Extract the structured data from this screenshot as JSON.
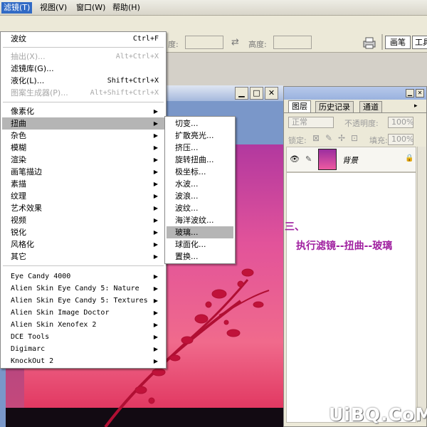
{
  "menubar": {
    "items": [
      "滤镜(T)",
      "视图(V)",
      "窗口(W)",
      "帮助(H)"
    ]
  },
  "optionsbar": {
    "partial_label": "度:",
    "swap_icon": "⇄",
    "height_label": "高度:",
    "brushes_tab": "画笔",
    "tools_tab": "工具"
  },
  "filter_menu": {
    "top_items": [
      {
        "label": "波纹",
        "shortcut": "Ctrl+F",
        "disabled": false
      },
      {
        "label": "抽出(X)...",
        "shortcut": "Alt+Ctrl+X",
        "disabled": true
      },
      {
        "label": "滤镜库(G)...",
        "shortcut": "",
        "disabled": false
      },
      {
        "label": "液化(L)...",
        "shortcut": "Shift+Ctrl+X",
        "disabled": false
      },
      {
        "label": "图案生成器(P)...",
        "shortcut": "Alt+Shift+Ctrl+X",
        "disabled": true
      }
    ],
    "category_items": [
      "像素化",
      "扭曲",
      "杂色",
      "模糊",
      "渲染",
      "画笔描边",
      "素描",
      "纹理",
      "艺术效果",
      "视频",
      "锐化",
      "风格化",
      "其它"
    ],
    "highlighted_category": "扭曲",
    "plugin_items": [
      "Eye Candy 4000",
      "Alien Skin Eye Candy 5: Nature",
      "Alien Skin Eye Candy 5: Textures",
      "Alien Skin Image Doctor",
      "Alien Skin Xenofex 2",
      "DCE Tools",
      "Digimarc",
      "KnockOut 2"
    ]
  },
  "distort_submenu": {
    "items": [
      "切变...",
      "扩散亮光...",
      "挤压...",
      "旋转扭曲...",
      "极坐标...",
      "水波...",
      "波浪...",
      "波纹...",
      "海洋波纹...",
      "玻璃...",
      "球面化...",
      "置换..."
    ],
    "highlighted": "玻璃..."
  },
  "layers_panel": {
    "tabs": [
      "图层",
      "历史记录",
      "通道"
    ],
    "blend_mode": "正常",
    "opacity_label": "不透明度:",
    "opacity_value": "100%",
    "lock_label": "锁定:",
    "fill_label": "填充:",
    "fill_value": "100%",
    "layer_name": "背景"
  },
  "annotation": {
    "step": "三、",
    "instruction": "执行滤镜--扭曲--玻璃"
  },
  "watermark": "UiBQ.CoM",
  "colors": {
    "highlight": "#b5b5b5",
    "menubar_active": "#316ac5",
    "annotation": "#a020a0",
    "canvas_pink": "#e94a7f"
  }
}
